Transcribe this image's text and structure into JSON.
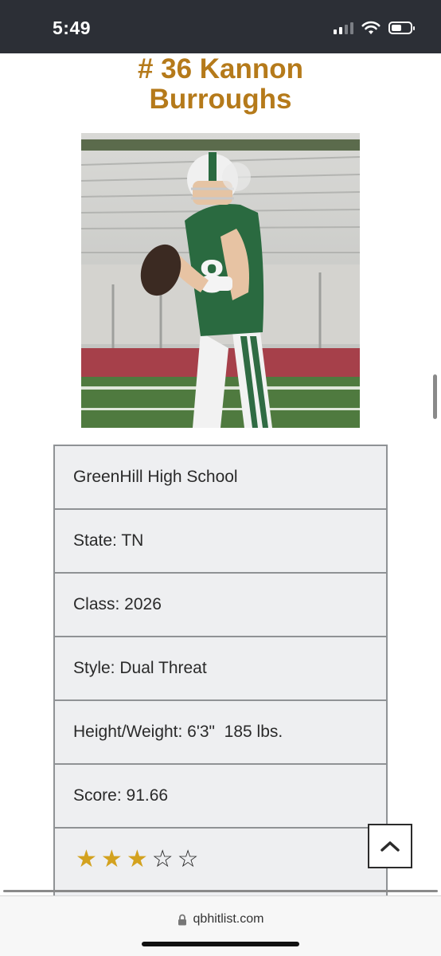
{
  "status_bar": {
    "time": "5:49",
    "icons": [
      "cellular-signal-icon",
      "wifi-icon",
      "battery-icon"
    ]
  },
  "player": {
    "title_line1": "# 36 Kannon",
    "title_line2": "Burroughs",
    "photo_icon": "football-player-photo",
    "accent_color": "#b57a1a"
  },
  "info": {
    "school": "GreenHill High School",
    "state": "State: TN",
    "class": "Class: 2026",
    "style": "Style: Dual Threat",
    "height_weight": "Height/Weight: 6'3\"  185 lbs.",
    "score": "Score: 91.66",
    "rating": {
      "stars_filled": 3,
      "stars_total": 5,
      "star_color": "#d3a21f"
    }
  },
  "controls": {
    "scroll_top_icon": "chevron-up-icon"
  },
  "browser": {
    "url": "qbhitlist.com",
    "lock_icon": "lock-icon"
  }
}
